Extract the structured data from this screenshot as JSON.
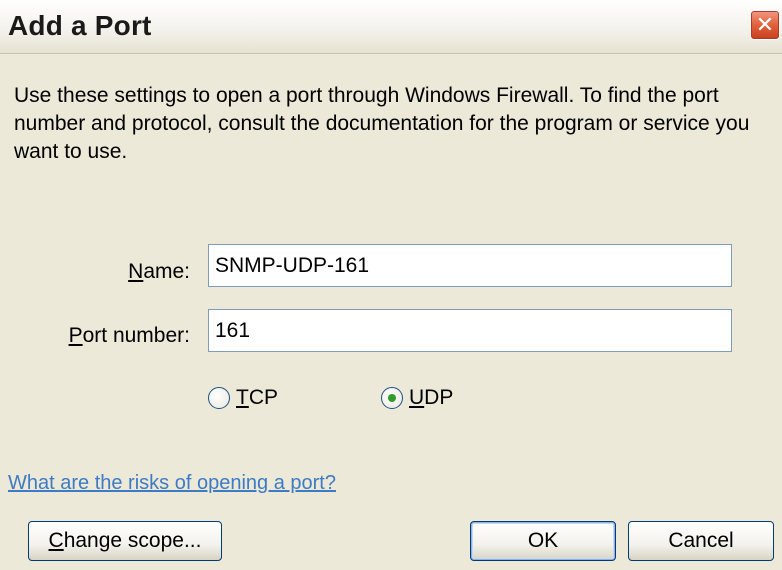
{
  "window": {
    "title": "Add a Port",
    "close_glyph": "✕"
  },
  "description": "Use these settings to open a port through Windows Firewall. To find the port number and protocol, consult the documentation for the program or service you want to use.",
  "form": {
    "name_label_key": "N",
    "name_label_rest": "ame:",
    "name_value": "SNMP-UDP-161",
    "port_label_key": "P",
    "port_label_rest": "ort number:",
    "port_value": "161",
    "protocol": {
      "tcp_key": "T",
      "tcp_rest": "CP",
      "udp_key": "U",
      "udp_rest": "DP",
      "selected": "UDP"
    }
  },
  "risks_link": "What are the risks of opening a port?",
  "buttons": {
    "change_scope_key": "C",
    "change_scope_rest": "hange scope...",
    "ok": "OK",
    "cancel": "Cancel"
  },
  "colors": {
    "dialog_bg": "#ece9d8",
    "link": "#3d7bc4",
    "close_button": "#e2613d",
    "radio_selected": "#2e9d2e"
  },
  "icons": {
    "close": "close-icon",
    "radio_checked": "radio-checked-icon",
    "radio_unchecked": "radio-unchecked-icon"
  }
}
